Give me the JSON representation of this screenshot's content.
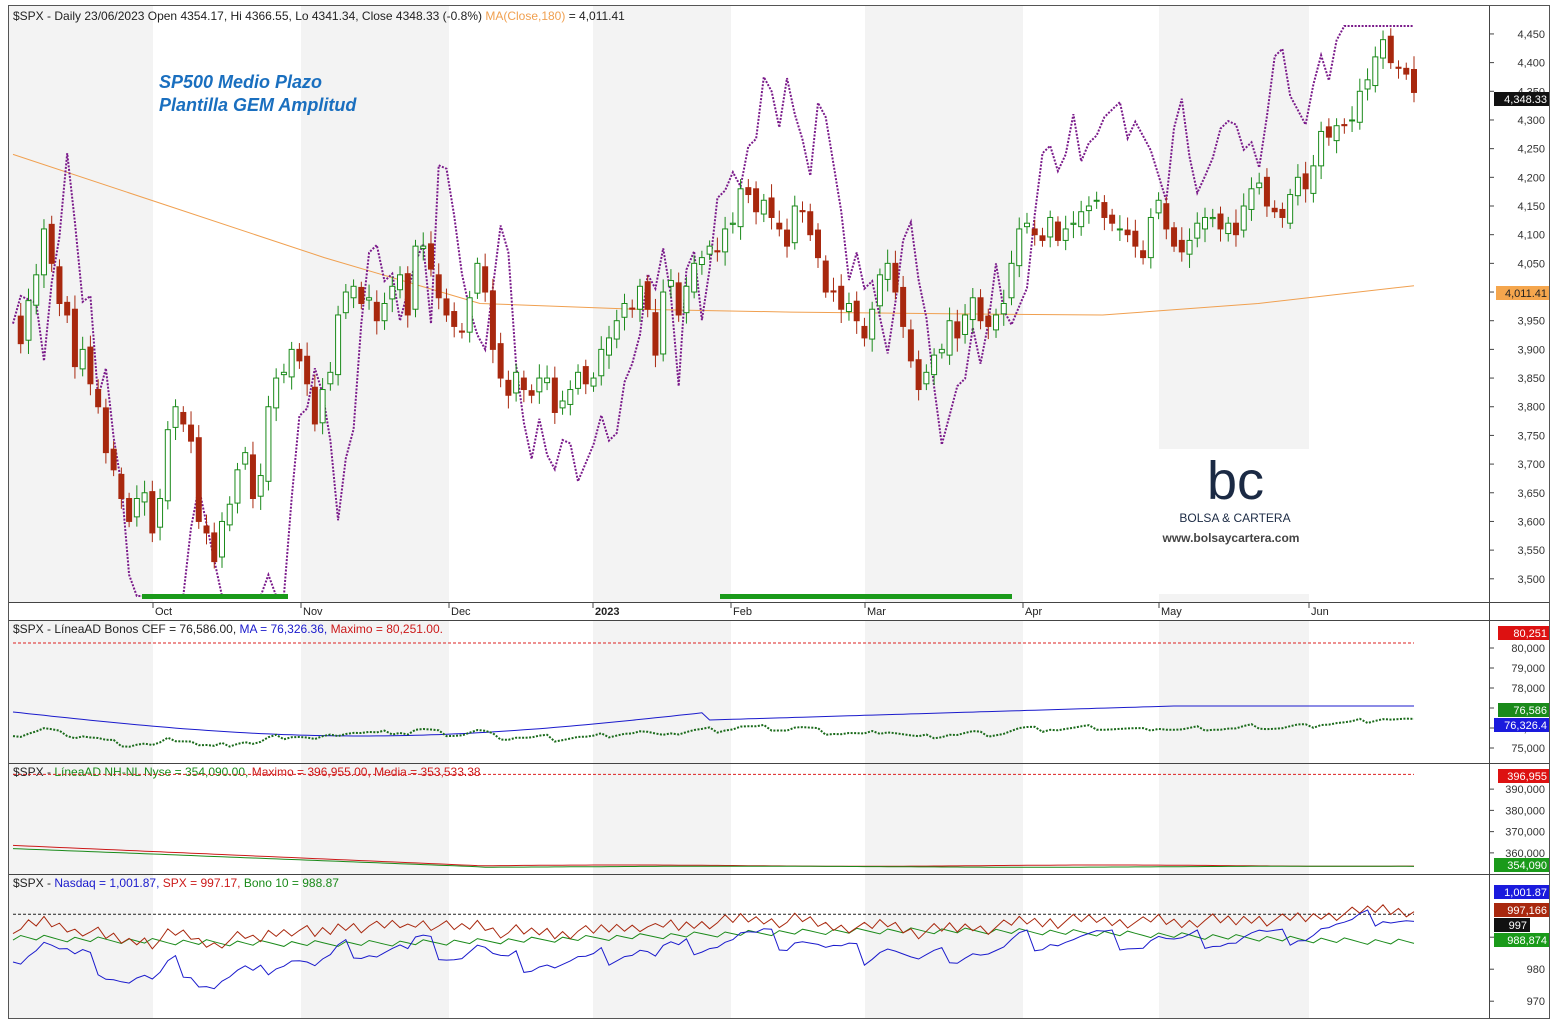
{
  "colors": {
    "bull": "#1a8a1a",
    "bear": "#a8280e",
    "ma_orange": "#f0a050",
    "purple": "#7a1a8a",
    "blue": "#1a1acc",
    "red": "#cc1a1a",
    "green": "#1a8a1a",
    "shade": "#f2f2f2",
    "title_blue": "#1a6fbf"
  },
  "price_pane": {
    "header_prefix": "$SPX - Daily 23/06/2023 Open 4354.17, Hi 4366.55, Lo 4341.34, Close 4348.33 (-0.8%) ",
    "header_ma_label": "MA(Close,180)",
    "header_ma_value": " = 4,011.41",
    "annotation_line1": "SP500 Medio Plazo",
    "annotation_line2": "Plantilla GEM Amplitud",
    "last_price_tag": "4,348.33",
    "ma_tag": "4,011.41",
    "y_ticks": [
      "3,500",
      "3,550",
      "3,600",
      "3,650",
      "3,700",
      "3,750",
      "3,800",
      "3,850",
      "3,900",
      "3,950",
      "4,000",
      "4,050",
      "4,100",
      "4,150",
      "4,200",
      "4,250",
      "4,300",
      "4,350",
      "4,400",
      "4,450"
    ],
    "ylim": [
      3470,
      4490
    ]
  },
  "time_axis": {
    "months": [
      "Oct",
      "Nov",
      "Dec",
      "2023",
      "Feb",
      "Mar",
      "Apr",
      "May",
      "Jun"
    ]
  },
  "logo": {
    "mark": "bc",
    "name": "BOLSA & CARTERA",
    "url": "www.bolsaycartera.com"
  },
  "pane2": {
    "title_prefix": "$SPX - ",
    "series1_label": "LíneaAD Bonos CEF = 76,586.00, ",
    "series2_label": "MA = 76,326.36, ",
    "series3_label": "Maximo = 80,251.00.",
    "y_ticks": [
      "75,000",
      "76,000",
      "77,000",
      "78,000",
      "79,000",
      "80,000"
    ],
    "tag_max": "80,251",
    "tag_s1": "76,586",
    "tag_s2": "76,326.4",
    "ylim": [
      74600,
      80600
    ]
  },
  "pane3": {
    "title_prefix": "$SPX - ",
    "series1_label": "LíneaAD NH-NL Nyse = 354,090.00, ",
    "series2_label": "Maximo = 396,955.00, ",
    "series3_label": "Media = 353,533.38",
    "y_ticks": [
      "360,000",
      "370,000",
      "380,000",
      "390,000"
    ],
    "tag_max": "396,955",
    "tag_s1": "354,090",
    "ylim": [
      351000,
      399000
    ]
  },
  "pane4": {
    "title_prefix": "$SPX - ",
    "series1_label": "Nasdaq = 1,001.87, ",
    "series2_label": "SPX = 997.17, ",
    "series3_label": "Bono 10 = 988.87",
    "y_ticks": [
      "970",
      "980",
      "990"
    ],
    "tag_nasdaq": "1,001.87",
    "tag_spx": "997,166",
    "tag_ref": "997",
    "tag_bono": "988,874",
    "ylim": [
      966,
      1006
    ]
  },
  "chart_data": {
    "type": "line",
    "title": "$SPX - Daily 23/06/2023",
    "series": [
      {
        "name": "$SPX",
        "values": [
          3960,
          3910,
          3985,
          4030,
          4110,
          4050,
          3980,
          3960,
          3870,
          3900,
          3840,
          3800,
          3720,
          3690,
          3640,
          3600,
          3640,
          3650,
          3580,
          3640,
          3760,
          3800,
          3770,
          3740,
          3600,
          3580,
          3530,
          3600,
          3630,
          3690,
          3720,
          3640,
          3680,
          3800,
          3850,
          3860,
          3900,
          3880,
          3840,
          3770,
          3830,
          3860,
          3960,
          4000,
          4010,
          3980,
          3990,
          3950,
          3980,
          4010,
          4030,
          3960,
          4080,
          4080,
          4040,
          3990,
          3960,
          3940,
          3930,
          3990,
          4050,
          4000,
          3900,
          3850,
          3820,
          3860,
          3830,
          3820,
          3850,
          3850,
          3790,
          3810,
          3830,
          3860,
          3840,
          3850,
          3900,
          3920,
          3950,
          3980,
          3970,
          4010,
          3970,
          3890,
          4000,
          4020,
          3960,
          4010,
          4050,
          4060,
          4080,
          4070,
          4110,
          4120,
          4180,
          4170,
          4140,
          4160,
          4130,
          4110,
          4080,
          4150,
          4140,
          4100,
          4060,
          4000,
          4000,
          3970,
          3980,
          3950,
          3920,
          3970,
          4030,
          4050,
          4000,
          3940,
          3880,
          3830,
          3860,
          3890,
          3900,
          3950,
          3920,
          3960,
          3990,
          3950,
          3940,
          3960,
          3980,
          4050,
          4110,
          4120,
          4100,
          4090,
          4130,
          4090,
          4110,
          4120,
          4140,
          4150,
          4160,
          4130,
          4120,
          4110,
          4100,
          4080,
          4060,
          4130,
          4160,
          4110,
          4080,
          4070,
          4090,
          4120,
          4130,
          4130,
          4110,
          4120,
          4100,
          4150,
          4180,
          4190,
          4150,
          4140,
          4130,
          4170,
          4200,
          4180,
          4220,
          4280,
          4270,
          4290,
          4290,
          4300,
          4350,
          4370,
          4410,
          4440,
          4400,
          4390,
          4380,
          4348
        ]
      },
      {
        "name": "MA(Close,180)",
        "values": [
          4240,
          4150,
          4060,
          3980,
          3970,
          3965,
          3962,
          3960,
          3980,
          4011
        ]
      }
    ],
    "ylim": [
      3470,
      4490
    ]
  }
}
